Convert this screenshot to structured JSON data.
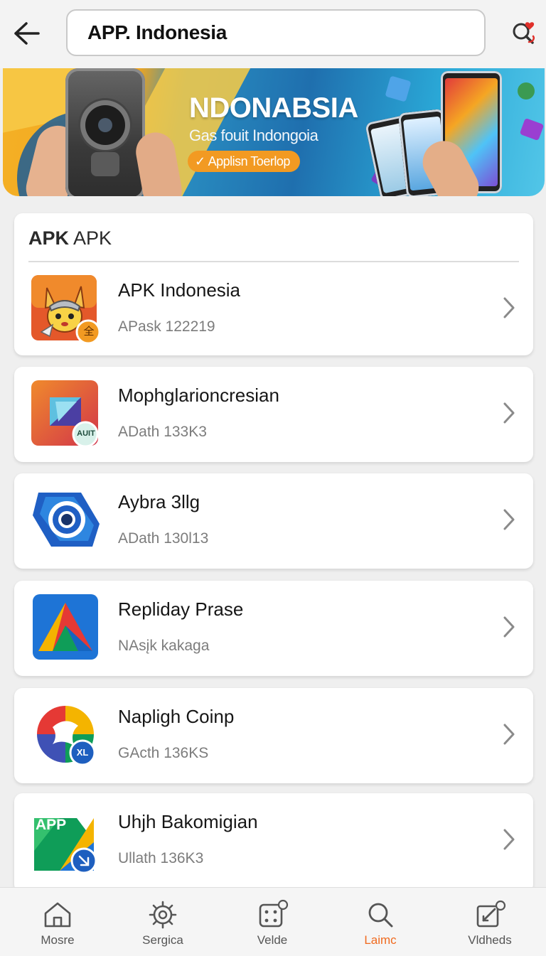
{
  "header": {
    "search_value": "APP. Indonesia"
  },
  "banner": {
    "title": "NDONABSIA",
    "subtitle": "Gas fouit Indongoia",
    "button_label": "Applisn Toerlop"
  },
  "section": {
    "title_bold": "APK",
    "title_rest": " APK"
  },
  "apps": [
    {
      "name": "APK Indonesia",
      "meta": "APask 122219",
      "badge": "全",
      "icon": "fox-warrior-app-icon"
    },
    {
      "name": "Mophglarioncresian",
      "meta": "ADath 133K3",
      "badge": "AUIT",
      "icon": "folder-app-icon"
    },
    {
      "name": "Aybra 3llg",
      "meta": "ADath 130l13",
      "badge": "",
      "icon": "blue-ring-app-icon"
    },
    {
      "name": "Repliday Prase",
      "meta": "NAsįk kakaga",
      "badge": "",
      "icon": "triangle-app-icon"
    },
    {
      "name": "Napligh Coinp",
      "meta": "GActh 136KS",
      "badge": "XL",
      "icon": "swirl-app-icon"
    },
    {
      "name": "Uhjh Bakomigian",
      "meta": "Ullath 136K3",
      "badge": "APP",
      "icon": "app-logo-icon"
    }
  ],
  "nav": [
    {
      "label": "Mosre",
      "icon": "home-icon",
      "active": false
    },
    {
      "label": "Sergica",
      "icon": "gear-icon",
      "active": false
    },
    {
      "label": "Velde",
      "icon": "dice-icon",
      "active": false
    },
    {
      "label": "Laimc",
      "icon": "search-icon",
      "active": true
    },
    {
      "label": "Vldheds",
      "icon": "edit-icon",
      "active": false
    }
  ],
  "colors": {
    "accent": "#f06a1f",
    "card_bg": "#ffffff",
    "page_bg": "#efefef"
  }
}
